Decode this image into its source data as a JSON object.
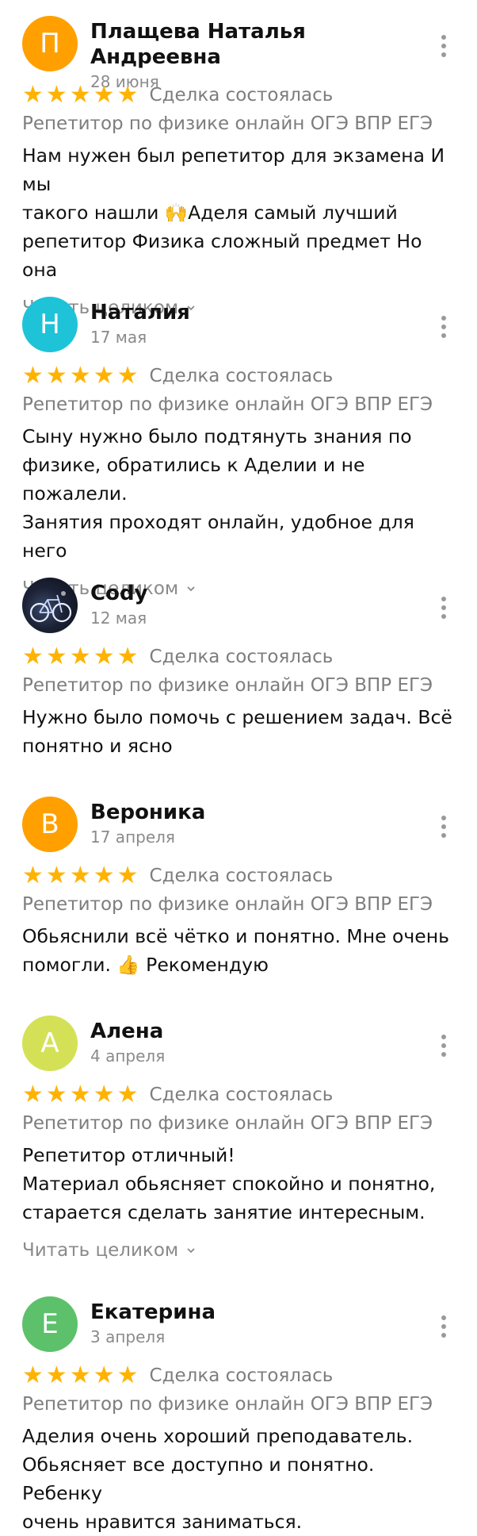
{
  "reviews": [
    {
      "initial": "П",
      "avatar_color": "#ffa000",
      "name": "Плащева Наталья Андреевна",
      "date": "28 июня",
      "deal": "Сделка состоялась",
      "service": "Репетитор по физике онлайн ОГЭ ВПР ЕГЭ",
      "text": "Нам нужен был репетитор для экзамена И мы\nтакого нашли 🙌Аделя самый лучший\nрепетитор Физика сложный предмет Но она",
      "read_more": "Читать целиком"
    },
    {
      "initial": "Н",
      "avatar_color": "#1ec3d8",
      "name": "Наталия",
      "date": "17 мая",
      "deal": "Сделка состоялась",
      "service": "Репетитор по физике онлайн ОГЭ ВПР ЕГЭ",
      "text": "Сыну нужно было подтянуть знания по\nфизике, обратились к Аделии и не пожалели.\nЗанятия проходят онлайн, удобное для него",
      "read_more": "Читать целиком"
    },
    {
      "initial": "",
      "avatar_color": "#141a2a",
      "name": "Cody",
      "date": "12 мая",
      "deal": "Сделка состоялась",
      "service": "Репетитор по физике онлайн ОГЭ ВПР ЕГЭ",
      "text": "Нужно было помочь с решением задач. Всё\nпонятно и ясно",
      "read_more": ""
    },
    {
      "initial": "В",
      "avatar_color": "#ffa000",
      "name": "Вероника",
      "date": "17 апреля",
      "deal": "Сделка состоялась",
      "service": "Репетитор по физике онлайн ОГЭ ВПР ЕГЭ",
      "text": "Обьяснили всё чётко и понятно. Мне очень\nпомогли. 👍 Рекомендую",
      "read_more": ""
    },
    {
      "initial": "А",
      "avatar_color": "#d4e157",
      "name": "Алена",
      "date": "4 апреля",
      "deal": "Сделка состоялась",
      "service": "Репетитор по физике онлайн ОГЭ ВПР ЕГЭ",
      "text": "Репетитор отличный!\nМатериал обьясняет спокойно и понятно,\nстарается сделать занятие интересным.",
      "read_more": "Читать целиком"
    },
    {
      "initial": "Е",
      "avatar_color": "#5cc16a",
      "name": "Екатерина",
      "date": "3 апреля",
      "deal": "Сделка состоялась",
      "service": "Репетитор по физике онлайн ОГЭ ВПР ЕГЭ",
      "text": "Аделия очень хороший преподаватель.\nОбьясняет все доступно и понятно. Ребенку\nочень нравится заниматься.",
      "read_more": ""
    }
  ],
  "rating_stars": 5,
  "star_color": "#ffb300"
}
